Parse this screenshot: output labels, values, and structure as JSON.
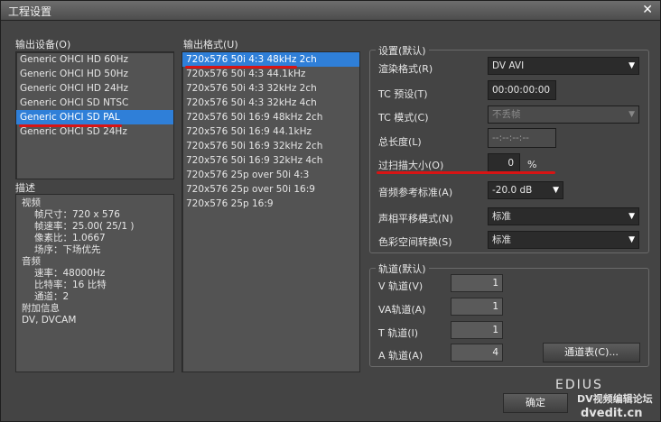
{
  "window": {
    "title": "工程设置",
    "close_glyph": "✕"
  },
  "output_device": {
    "label": "输出设备(O)",
    "items": [
      "Generic OHCI HD 60Hz",
      "Generic OHCI HD 50Hz",
      "Generic OHCI HD 24Hz",
      "Generic OHCI SD NTSC",
      "Generic OHCI SD PAL",
      "Generic OHCI SD 24Hz"
    ],
    "selected_index": 4
  },
  "output_format": {
    "label": "输出格式(U)",
    "items": [
      "720x576 50i 4:3 48kHz 2ch",
      "720x576 50i 4:3 44.1kHz",
      "720x576 50i 4:3 32kHz 2ch",
      "720x576 50i 4:3 32kHz 4ch",
      "720x576 50i 16:9 48kHz 2ch",
      "720x576 50i 16:9 44.1kHz",
      "720x576 50i 16:9 32kHz 2ch",
      "720x576 50i 16:9 32kHz 4ch",
      "720x576 25p over 50i 4:3",
      "720x576 25p over 50i 16:9",
      "720x576 25p 16:9"
    ],
    "selected_index": 0
  },
  "description": {
    "label": "描述",
    "lines": [
      "视频",
      "帧尺寸：720 x 576",
      "帧速率：25.00( 25/1 )",
      "像素比：1.0667",
      "场序：下场优先",
      "音频",
      "速率：48000Hz",
      "比特率：16 比特",
      "通道：2",
      "附加信息",
      "DV, DVCAM"
    ]
  },
  "settings": {
    "group_title": "设置(默认)",
    "render_format": {
      "label": "渲染格式(R)",
      "value": "DV AVI"
    },
    "tc_preset": {
      "label": "TC 预设(T)",
      "value": "00:00:00:00"
    },
    "tc_mode": {
      "label": "TC 模式(C)",
      "value": "不丢帧"
    },
    "total_length": {
      "label": "总长度(L)",
      "value": "--:--:--:--"
    },
    "overscan": {
      "label": "过扫描大小(O)",
      "value": "0",
      "unit": "%"
    },
    "audio_ref": {
      "label": "音频参考标准(A)",
      "value": "-20.0 dB"
    },
    "pan_mode": {
      "label": "声相平移模式(N)",
      "value": "标准"
    },
    "color_space": {
      "label": "色彩空间转换(S)",
      "value": "标准"
    }
  },
  "tracks": {
    "group_title": "轨道(默认)",
    "v": {
      "label": "V 轨道(V)",
      "value": "1"
    },
    "va": {
      "label": "VA轨道(A)",
      "value": "1"
    },
    "t": {
      "label": "T 轨道(I)",
      "value": "1"
    },
    "a": {
      "label": "A 轨道(A)",
      "value": "4"
    },
    "channel_table_button": "通道表(C)..."
  },
  "footer": {
    "ok_button": "确定"
  },
  "watermarks": {
    "brand": "EDIUS",
    "forum": "DV视频编辑论坛",
    "site": "dvedit.cn"
  },
  "colors": {
    "selection": "#2f7fd8",
    "underline": "#d81414"
  }
}
